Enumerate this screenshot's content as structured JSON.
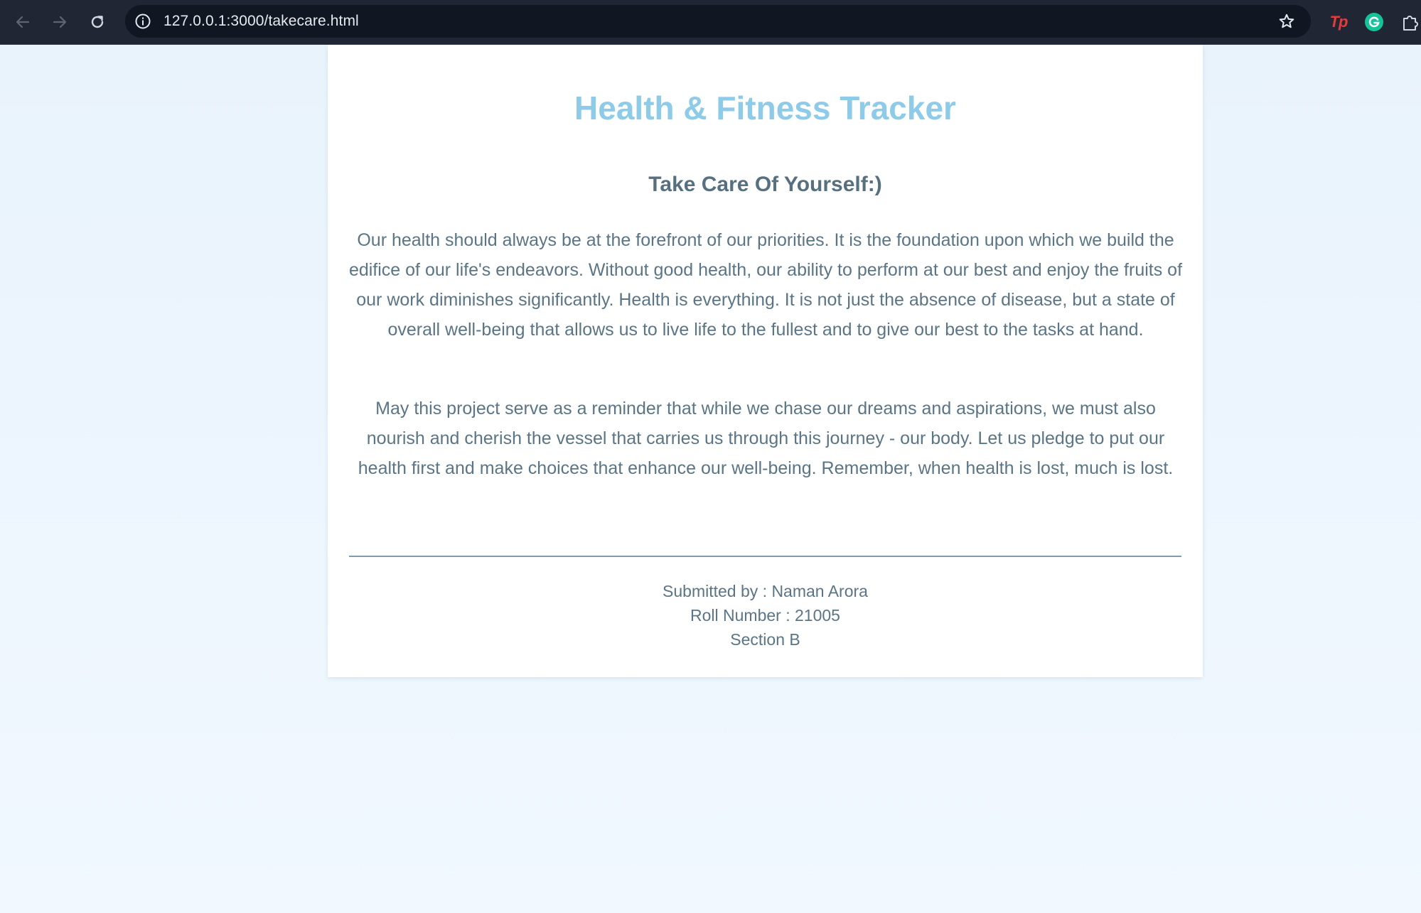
{
  "browser": {
    "url": "127.0.0.1:3000/takecare.html",
    "extensions": {
      "tp_label": "Tp"
    }
  },
  "icons": {
    "back": "arrow-left-icon",
    "forward": "arrow-right-icon",
    "reload": "reload-icon",
    "site_info": "info-circle-icon",
    "bookmark": "star-icon",
    "grammarly": "grammarly-icon",
    "extensions": "puzzle-icon"
  },
  "colors": {
    "title": "#8ecbe8",
    "text": "#5a7585",
    "page_background": "#f0f7fe",
    "card_background": "#ffffff",
    "browser_bar": "#202634"
  },
  "main": {
    "title": "Health & Fitness Tracker",
    "heading": "Take Care Of Yourself:)",
    "paragraphs": [
      "Our health should always be at the forefront of our priorities. It is the foundation upon which we build the edifice of our life's endeavors. Without good health, our ability to perform at our best and enjoy the fruits of our work diminishes significantly. Health is everything. It is not just the absence of disease, but a state of overall well-being that allows us to live life to the fullest and to give our best to the tasks at hand.",
      "May this project serve as a reminder that while we chase our dreams and aspirations, we must also nourish and cherish the vessel that carries us through this journey - our body. Let us pledge to put our health first and make choices that enhance our well-being. Remember, when health is lost, much is lost."
    ]
  },
  "footer": {
    "submitted_by": "Submitted by : Naman Arora",
    "roll_number": "Roll Number : 21005",
    "section": "Section B"
  }
}
